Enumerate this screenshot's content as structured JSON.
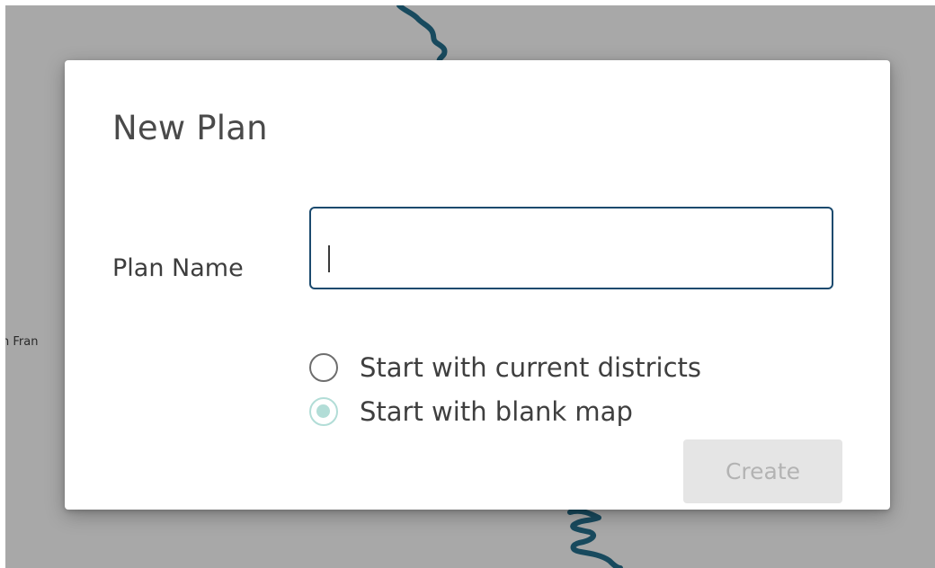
{
  "map": {
    "label": "n Fran"
  },
  "modal": {
    "title": "New Plan",
    "plan_name_label": "Plan Name",
    "plan_name_input": {
      "value": "",
      "placeholder": ""
    },
    "options": [
      {
        "label": "Start with current districts",
        "checked": false
      },
      {
        "label": "Start with blank map",
        "checked": true
      }
    ],
    "create_label": "Create",
    "create_disabled": true
  },
  "colors": {
    "overlay": "#a8a8a8",
    "input_border": "#1b4a6e",
    "radio_checked": "#b2ddd7",
    "map_line": "#184a5e",
    "button_disabled_bg": "#e5e5e5",
    "button_disabled_text": "#b3b3b3"
  }
}
